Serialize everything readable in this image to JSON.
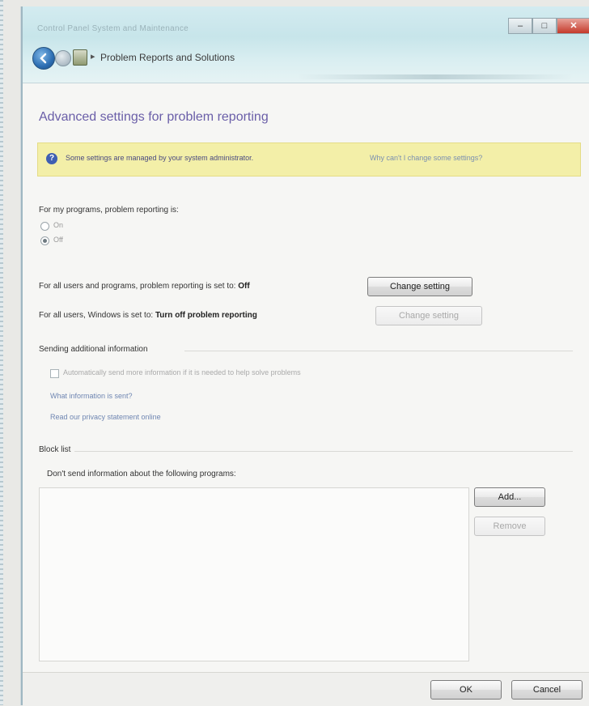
{
  "window": {
    "address_blur": "Control Panel  System and Maintenance",
    "breadcrumb": "Problem Reports and Solutions",
    "controls": {
      "minimize": "–",
      "maximize": "□",
      "close": "✕"
    }
  },
  "page": {
    "title": "Advanced settings for problem reporting",
    "infobar": {
      "text": "Some settings are managed by your system administrator.",
      "link": "Why can't I change some settings?"
    },
    "my_programs": {
      "label": "For my programs, problem reporting is:",
      "options": [
        {
          "label": "On",
          "selected": false
        },
        {
          "label": "Off",
          "selected": true
        }
      ]
    },
    "all_users": {
      "label_prefix": "For all users and programs, problem reporting is set to:",
      "value": "Off",
      "button": "Change setting"
    },
    "windows_setting": {
      "label_prefix": "For all users, Windows is set to:",
      "value": "Turn off problem reporting",
      "button": "Change setting"
    },
    "additional_info": {
      "heading": "Sending additional information",
      "checkbox_label": "Automatically send more information if it is needed to help solve problems",
      "checked": false,
      "link_what": "What information is sent?",
      "link_privacy": "Read our privacy statement online"
    },
    "block_list": {
      "heading": "Block list",
      "label": "Don't send information about the following programs:",
      "add_button": "Add...",
      "remove_button": "Remove",
      "items": []
    }
  },
  "footer": {
    "ok": "OK",
    "cancel": "Cancel"
  }
}
